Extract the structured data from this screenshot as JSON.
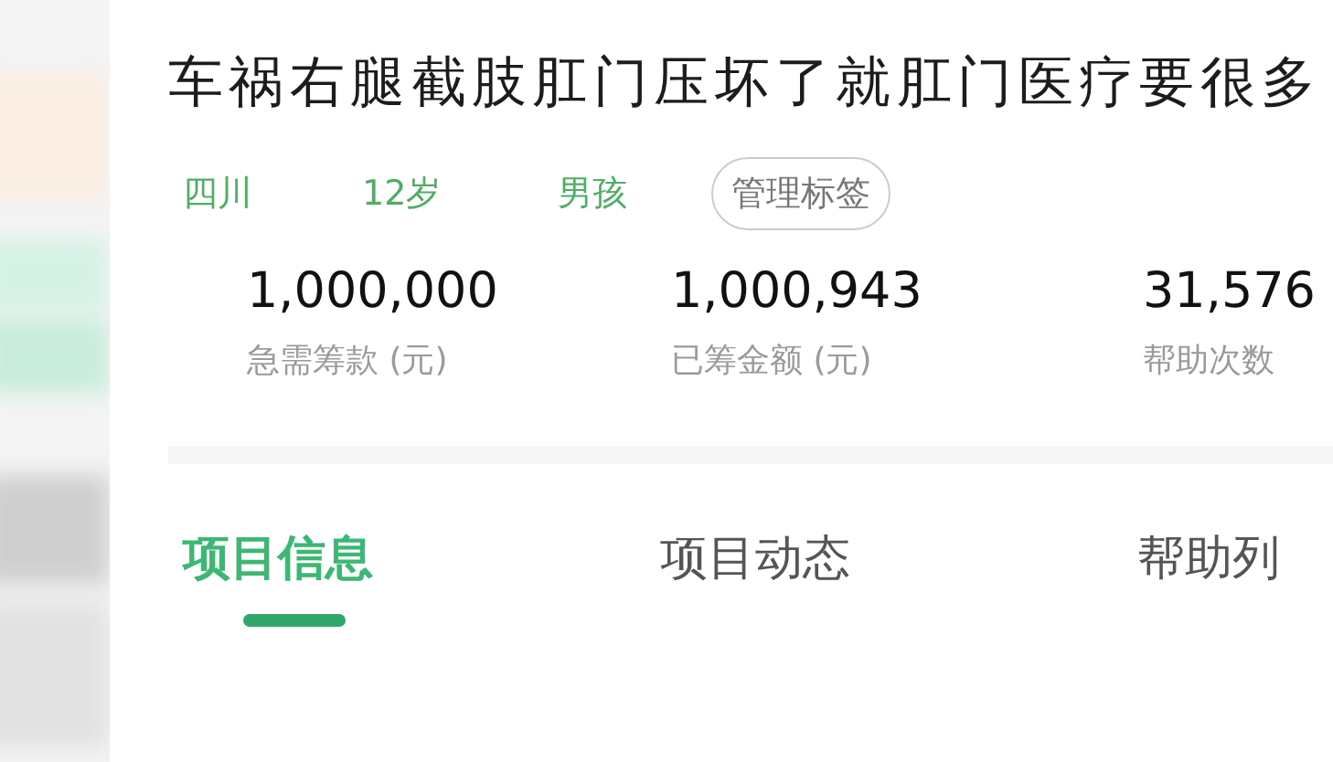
{
  "title": "车祸右腿截肢肛门压坏了就肛门医疗要很多",
  "tags": [
    {
      "label": "四川",
      "kind": "plain"
    },
    {
      "label": "12岁",
      "kind": "plain"
    },
    {
      "label": "男孩",
      "kind": "plain"
    },
    {
      "label": "管理标签",
      "kind": "button"
    }
  ],
  "stats": [
    {
      "value": "1,000,000",
      "label": "急需筹款 (元)"
    },
    {
      "value": "1,000,943",
      "label": "已筹金额 (元)"
    },
    {
      "value": "31,576",
      "label": "帮助次数"
    }
  ],
  "tabs": [
    {
      "label": "项目信息",
      "selected": true
    },
    {
      "label": "项目动态",
      "selected": false
    },
    {
      "label": "帮助列",
      "selected": false
    }
  ]
}
